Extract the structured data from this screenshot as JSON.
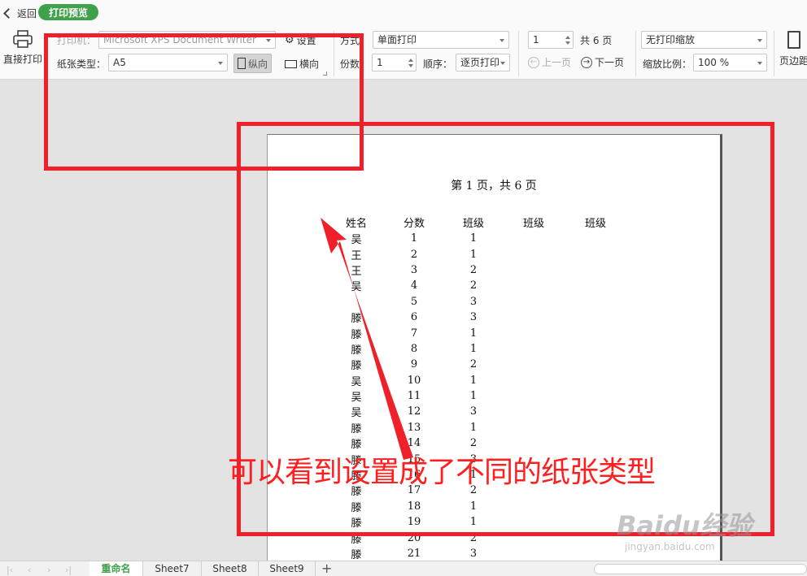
{
  "topbar": {
    "back_label": "返回",
    "tab_label": "打印预览"
  },
  "ribbon": {
    "direct_print_label": "直接打印",
    "printer_label": "打印机：",
    "printer_value": "Microsoft XPS Document Writer",
    "settings_label": "设置",
    "paper_type_label": "纸张类型：",
    "paper_type_value": "A5",
    "portrait_label": "纵向",
    "landscape_label": "横向",
    "mode_label": "方式：",
    "mode_value": "单面打印",
    "copies_label": "份数：",
    "copies_value": "1",
    "order_label": "顺序：",
    "order_value": "逐页打印",
    "page_value": "1",
    "total_pages_label": "共 6 页",
    "prev_page_label": "上一页",
    "next_page_label": "下一页",
    "scaling_value": "无打印缩放",
    "zoom_label": "缩放比例：",
    "zoom_value": "100 %",
    "margin_label": "页边距"
  },
  "page": {
    "title": "第 1 页，共 6 页",
    "headers": [
      "姓名",
      "分数",
      "班级",
      "班级",
      "班级"
    ],
    "rows": [
      [
        "吴",
        "1",
        "1"
      ],
      [
        "王",
        "2",
        "1"
      ],
      [
        "王",
        "3",
        "2"
      ],
      [
        "吴",
        "4",
        "2"
      ],
      [
        "",
        "5",
        "3"
      ],
      [
        "滕",
        "6",
        "3"
      ],
      [
        "滕",
        "7",
        "1"
      ],
      [
        "滕",
        "8",
        "1"
      ],
      [
        "滕",
        "9",
        "2"
      ],
      [
        "吴",
        "10",
        "1"
      ],
      [
        "吴",
        "11",
        "1"
      ],
      [
        "吴",
        "12",
        "3"
      ],
      [
        "滕",
        "13",
        "1"
      ],
      [
        "滕",
        "14",
        "2"
      ],
      [
        "滕",
        "15",
        "3"
      ],
      [
        "滕",
        "16",
        "1"
      ],
      [
        "滕",
        "17",
        "2"
      ],
      [
        "滕",
        "18",
        "1"
      ],
      [
        "滕",
        "19",
        "1"
      ],
      [
        "滕",
        "20",
        "2"
      ],
      [
        "滕",
        "21",
        "3"
      ]
    ]
  },
  "sheets": [
    "重命名",
    "Sheet7",
    "Sheet8",
    "Sheet9"
  ],
  "annotation": {
    "caption": "可以看到设置成了不同的纸张类型",
    "color": "#f0202a"
  },
  "watermark": {
    "line1": "Baidu经验",
    "line2": "jingyan.baidu.com"
  },
  "colors": {
    "accent": "#3fa14a"
  }
}
